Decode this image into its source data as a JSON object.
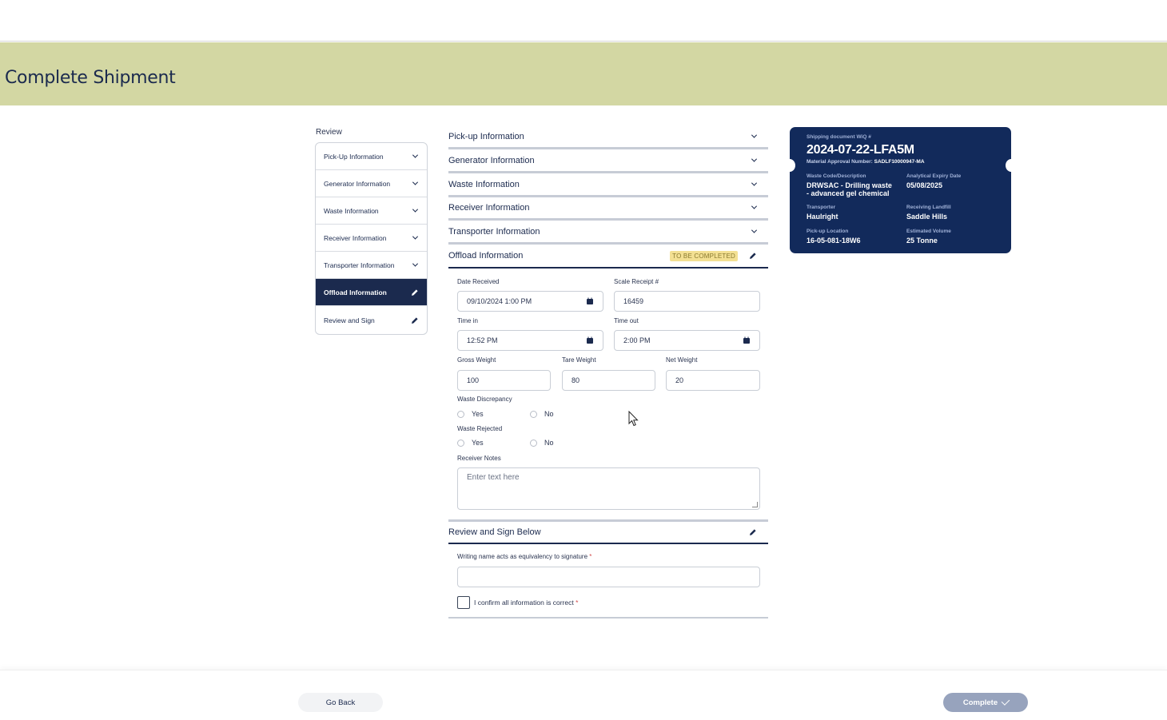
{
  "page": {
    "title": "Complete Shipment"
  },
  "review_nav": {
    "label": "Review",
    "items": [
      {
        "label": "Pick-Up Information",
        "icon": "chevron-down-icon",
        "active": false
      },
      {
        "label": "Generator Information",
        "icon": "chevron-down-icon",
        "active": false
      },
      {
        "label": "Waste Information",
        "icon": "chevron-down-icon",
        "active": false
      },
      {
        "label": "Receiver Information",
        "icon": "chevron-down-icon",
        "active": false
      },
      {
        "label": "Transporter Information",
        "icon": "chevron-down-icon",
        "active": false
      },
      {
        "label": "Offload Information",
        "icon": "pencil-icon",
        "active": true
      },
      {
        "label": "Review and Sign",
        "icon": "pencil-icon",
        "active": false
      }
    ]
  },
  "sections": {
    "pickup": "Pick-up Information",
    "generator": "Generator Information",
    "waste": "Waste Information",
    "receiver": "Receiver Information",
    "transporter": "Transporter Information",
    "offload": {
      "title": "Offload Information",
      "badge": "TO BE COMPLETED"
    },
    "review": "Review and Sign Below"
  },
  "offload_form": {
    "date_received": {
      "label": "Date Received",
      "value": "09/10/2024 1:00 PM"
    },
    "scale_receipt": {
      "label": "Scale Receipt #",
      "value": "16459"
    },
    "time_in": {
      "label": "Time in",
      "value": "12:52 PM"
    },
    "time_out": {
      "label": "Time out",
      "value": "2:00 PM"
    },
    "gross_weight": {
      "label": "Gross Weight",
      "value": "100"
    },
    "tare_weight": {
      "label": "Tare Weight",
      "value": "80"
    },
    "net_weight": {
      "label": "Net Weight",
      "value": "20"
    },
    "waste_discrepancy": {
      "label": "Waste Discrepancy",
      "yes": "Yes",
      "no": "No"
    },
    "waste_rejected": {
      "label": "Waste Rejected",
      "yes": "Yes",
      "no": "No"
    },
    "receiver_notes": {
      "label": "Receiver Notes",
      "placeholder": "Enter text here"
    }
  },
  "sign": {
    "signature_label": "Writing name acts as equivalency to signature",
    "required_mark": "*",
    "confirm_label": "I confirm all information is correct"
  },
  "ticket": {
    "doc_label": "Shipping document WiQ #",
    "doc_number": "2024-07-22-LFA5M",
    "approval_label": "Material Approval Number:",
    "approval_number": "SADLF10000947-MA",
    "waste_code_label": "Waste Code/Description",
    "waste_code_line1": "DRWSAC - Drilling waste",
    "waste_code_line2": "- advanced gel chemical",
    "expiry_label": "Analytical Expiry Date",
    "expiry_value": "05/08/2025",
    "transporter_label": "Transporter",
    "transporter_value": "Haulright",
    "landfill_label": "Receiving Landfill",
    "landfill_value": "Saddle Hills",
    "location_label": "Pick-up Location",
    "location_value": "16-05-081-18W6",
    "volume_label": "Estimated Volume",
    "volume_value": "25 Tonne"
  },
  "footer": {
    "back_label": "Go Back",
    "complete_label": "Complete"
  },
  "colors": {
    "banner": "#d3d7a3",
    "navy": "#1b2a4e",
    "ticket": "#122a5b",
    "badge": "#f3e093",
    "complete_disabled": "#97a3bd"
  }
}
